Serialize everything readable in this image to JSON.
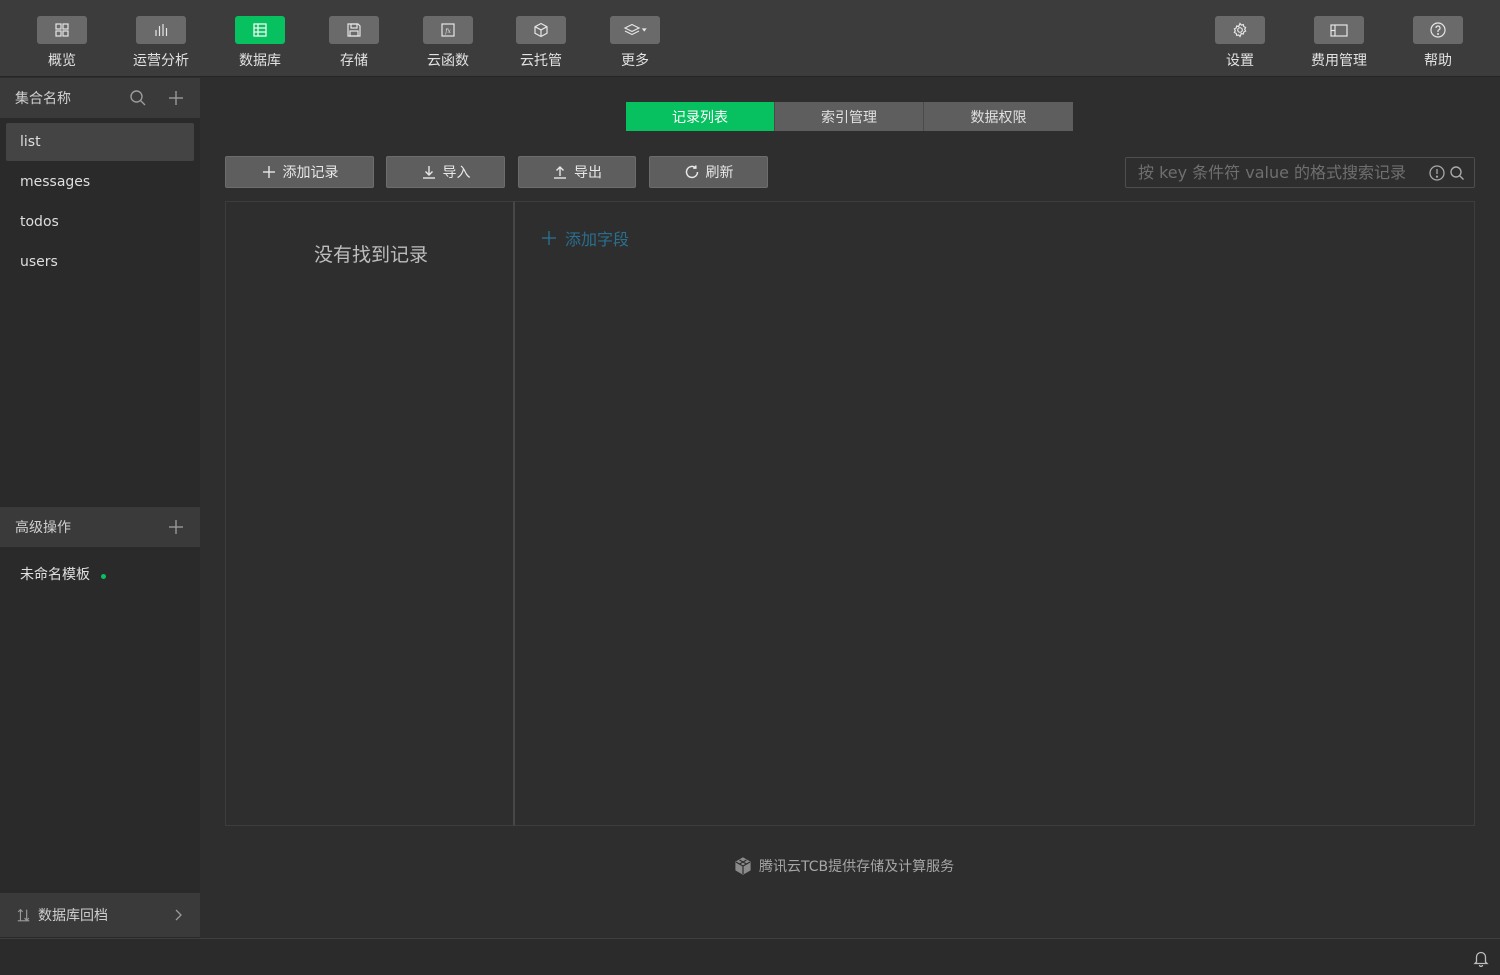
{
  "toolbar": {
    "left": [
      {
        "label": "概览",
        "icon": "grid-icon",
        "active": false
      },
      {
        "label": "运营分析",
        "icon": "bar-chart-icon",
        "active": false
      },
      {
        "label": "数据库",
        "icon": "database-icon",
        "active": true
      },
      {
        "label": "存储",
        "icon": "floppy-disk-icon",
        "active": false
      },
      {
        "label": "云函数",
        "icon": "function-icon",
        "active": false
      },
      {
        "label": "云托管",
        "icon": "cube-icon",
        "active": false
      },
      {
        "label": "更多",
        "icon": "layers-dropdown-icon",
        "active": false
      }
    ],
    "right": [
      {
        "label": "设置",
        "icon": "gear-icon"
      },
      {
        "label": "费用管理",
        "icon": "billing-icon"
      },
      {
        "label": "帮助",
        "icon": "help-circle-icon"
      }
    ],
    "accent_color": "#07c160"
  },
  "sidebar": {
    "collections_header": "集合名称",
    "collections": [
      {
        "name": "list",
        "selected": true
      },
      {
        "name": "messages",
        "selected": false
      },
      {
        "name": "todos",
        "selected": false
      },
      {
        "name": "users",
        "selected": false
      }
    ],
    "advanced_header": "高级操作",
    "template_item": "未命名模板",
    "rollback_label": "数据库回档"
  },
  "main": {
    "tabs": [
      {
        "label": "记录列表",
        "active": true
      },
      {
        "label": "索引管理",
        "active": false
      },
      {
        "label": "数据权限",
        "active": false
      }
    ],
    "actions": {
      "add_record": "添加记录",
      "import": "导入",
      "export": "导出",
      "refresh": "刷新"
    },
    "search_placeholder": "按 key 条件符 value 的格式搜索记录",
    "empty_text": "没有找到记录",
    "add_field": "添加字段",
    "footer_note": "腾讯云TCB提供存储及计算服务"
  }
}
